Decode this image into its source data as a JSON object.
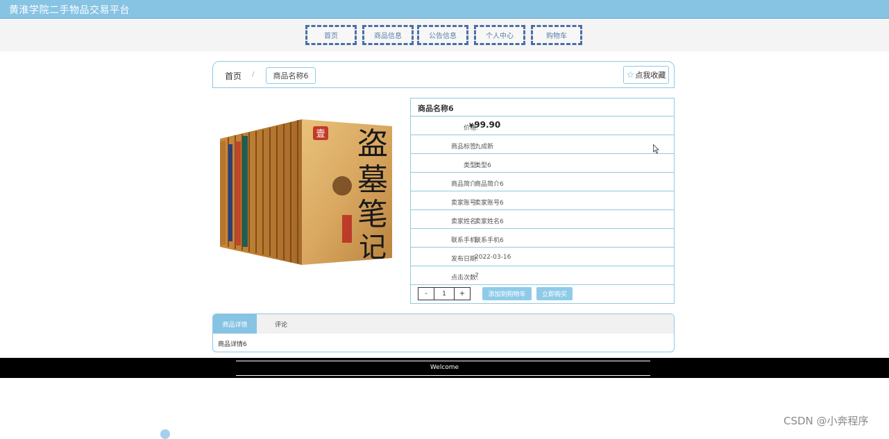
{
  "site": {
    "title": "黄淮学院二手物品交易平台"
  },
  "nav": [
    {
      "label": "首页"
    },
    {
      "label": "商品信息"
    },
    {
      "label": "公告信息"
    },
    {
      "label": "个人中心"
    },
    {
      "label": "购物车"
    }
  ],
  "breadcrumb": {
    "home": "首页",
    "separator": "/",
    "current": "商品名称6"
  },
  "favorite": {
    "label": "点我收藏",
    "icon": "star-outline-icon"
  },
  "product": {
    "name": "商品名称6",
    "image_icon": "book-set-cover-image",
    "price_label": "价格:",
    "currency": "¥",
    "price": "99.90",
    "fields": [
      {
        "label": "商品标签:",
        "value": "九成新"
      },
      {
        "label": "类型:",
        "value": "类型6"
      },
      {
        "label": "商品简介:",
        "value": "商品简介6"
      },
      {
        "label": "卖家账号:",
        "value": "卖家账号6"
      },
      {
        "label": "卖家姓名:",
        "value": "卖家姓名6"
      },
      {
        "label": "联系手机:",
        "value": "联系手机6"
      },
      {
        "label": "发布日期:",
        "value": "2022-03-16"
      },
      {
        "label": "点击次数:",
        "value": "7"
      }
    ]
  },
  "purchase": {
    "minus": "-",
    "quantity": "1",
    "plus": "+",
    "add_to_cart": "添加到购物车",
    "buy_now": "立即购买"
  },
  "tabs": {
    "details": "商品详情",
    "comments": "评论",
    "content": "商品详情6"
  },
  "footer": {
    "welcome": "Welcome"
  },
  "watermark": "CSDN @小奔程序",
  "colors": {
    "accent": "#87c3e3",
    "border": "#8fc8e4",
    "nav_border": "#4a6fa5",
    "footer": "#000000"
  }
}
